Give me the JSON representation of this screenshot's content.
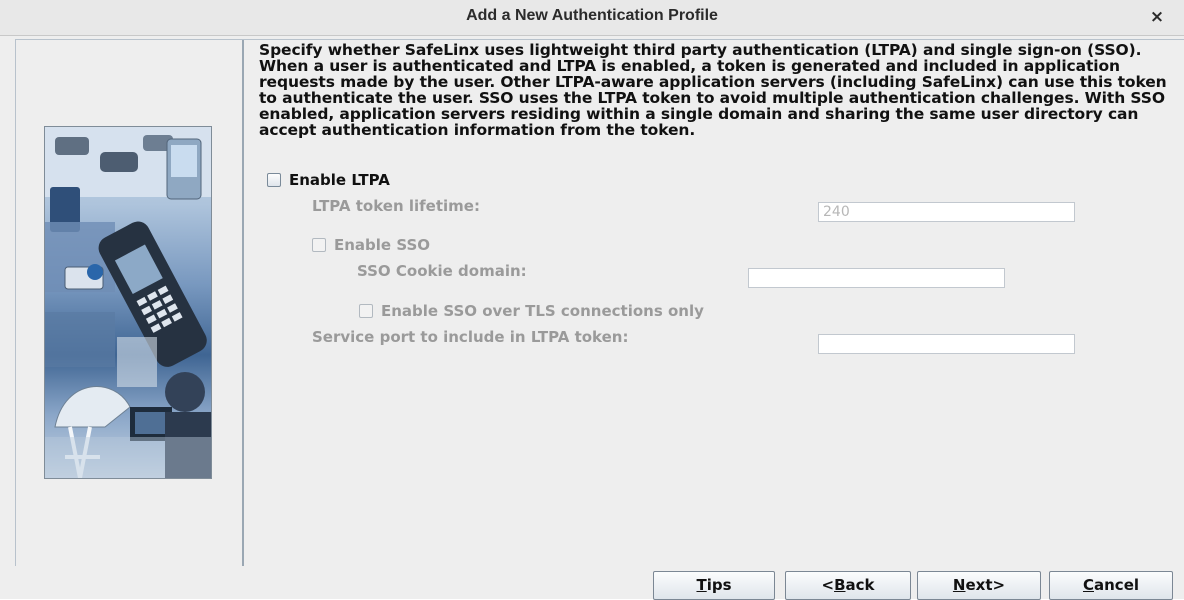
{
  "window": {
    "title": "Add a New Authentication Profile",
    "close_glyph": "×"
  },
  "description": "Specify whether SafeLinx uses lightweight third party authentication (LTPA) and single sign-on (SSO).  When a user is authenticated and LTPA is enabled, a token is generated and included in application requests made by the user. Other LTPA-aware application servers (including SafeLinx) can use this token to authenticate the user. SSO uses the LTPA token to avoid multiple authentication challenges. With SSO enabled, application servers residing within a single domain and sharing the same user directory can accept authentication information from the token.",
  "form": {
    "enable_ltpa": {
      "label": "Enable LTPA",
      "checked": false
    },
    "ltpa_lifetime": {
      "label": "LTPA token lifetime:",
      "value": "240"
    },
    "enable_sso": {
      "label": "Enable SSO",
      "checked": false
    },
    "sso_cookie_domain": {
      "label": "SSO Cookie domain:",
      "value": ""
    },
    "sso_tls_only": {
      "label": "Enable SSO over TLS connections only",
      "checked": false
    },
    "service_port": {
      "label": "Service port to include in LTPA token:",
      "value": ""
    }
  },
  "buttons": {
    "tips": {
      "mnemonic": "T",
      "rest": "ips"
    },
    "back": {
      "pre": "<",
      "mnemonic": "B",
      "rest": "ack"
    },
    "next": {
      "mnemonic": "N",
      "rest": "ext>"
    },
    "cancel": {
      "mnemonic": "C",
      "rest": "ancel"
    }
  },
  "icons": {
    "close": "close-icon",
    "side_image": "wizard-side-image"
  }
}
